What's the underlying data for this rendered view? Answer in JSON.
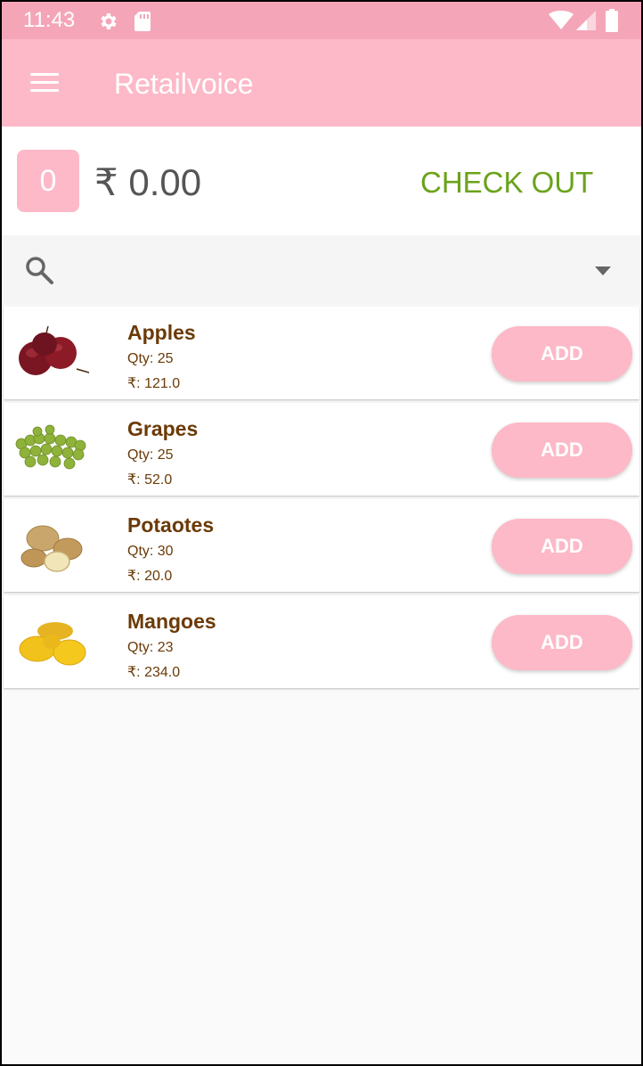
{
  "status_bar": {
    "time": "11:43",
    "icons": [
      "gear-icon",
      "sd-card-icon",
      "wifi-icon",
      "signal-icon",
      "battery-icon"
    ]
  },
  "app_bar": {
    "title": "Retailvoice",
    "menu_icon": "menu-icon"
  },
  "cart": {
    "count": "0",
    "total": "₹ 0.00",
    "checkout_label": "CHECK OUT"
  },
  "search": {
    "icon": "search-icon",
    "dropdown_icon": "dropdown-icon"
  },
  "products": [
    {
      "name": "Apples",
      "qty": "Qty: 25",
      "price": "₹: 121.0",
      "add_label": "ADD",
      "image": "apples-image"
    },
    {
      "name": "Grapes",
      "qty": "Qty: 25",
      "price": "₹: 52.0",
      "add_label": "ADD",
      "image": "grapes-image"
    },
    {
      "name": "Potaotes",
      "qty": "Qty: 30",
      "price": "₹: 20.0",
      "add_label": "ADD",
      "image": "potatoes-image"
    },
    {
      "name": "Mangoes",
      "qty": "Qty: 23",
      "price": "₹: 234.0",
      "add_label": "ADD",
      "image": "mangoes-image"
    }
  ],
  "colors": {
    "status_bar": "#f4a6b8",
    "app_bar": "#fdb9c8",
    "checkout": "#6aa31a",
    "product_text": "#6b3a07"
  }
}
